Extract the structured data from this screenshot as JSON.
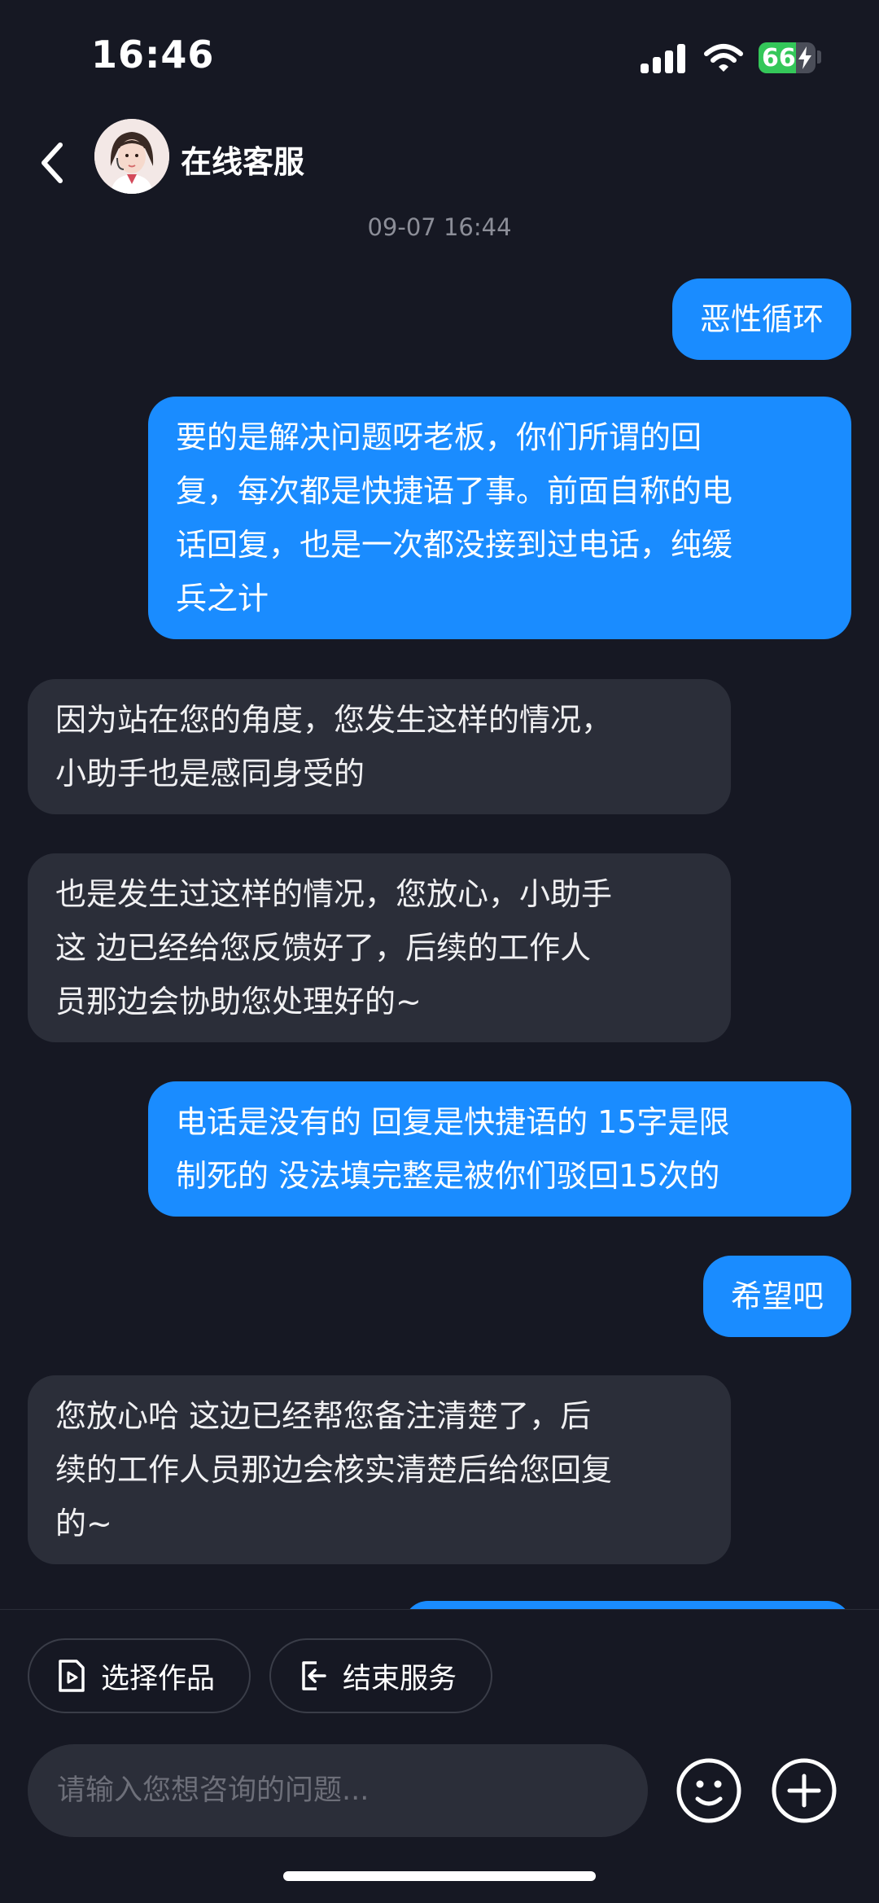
{
  "status_bar": {
    "time": "16:46",
    "battery_percent": "66",
    "battery_level": 0.66,
    "battery_color": "#34c759"
  },
  "header": {
    "back_icon": "chevron-left-icon",
    "title": "在线客服"
  },
  "chat": {
    "timestamp": "09-07 16:44",
    "messages": [
      {
        "from": "me",
        "text": "恶性循环"
      },
      {
        "from": "me",
        "text": "要的是解决问题呀老板，你们所谓的回\n复，每次都是快捷语了事。前面自称的电\n话回复，也是一次都没接到过电话，纯缓\n兵之计"
      },
      {
        "from": "agent",
        "text": "因为站在您的角度，您发生这样的情况，\n小助手也是感同身受的"
      },
      {
        "from": "agent",
        "text": "也是发生过这样的情况，您放心，小助手\n这 边已经给您反馈好了，后续的工作人\n员那边会协助您处理好的~"
      },
      {
        "from": "me",
        "text": "电话是没有的 回复是快捷语的 15字是限\n制死的 没法填完整是被你们驳回15次的"
      },
      {
        "from": "me",
        "text": "希望吧"
      },
      {
        "from": "agent",
        "text": "您放心哈 这边已经帮您备注清楚了，后\n续的工作人员那边会核实清楚后给您回复\n的~"
      }
    ]
  },
  "bottom_bar": {
    "select_work_label": "选择作品",
    "end_service_label": "结束服务",
    "input_placeholder": "请输入您想咨询的问题...",
    "emoji_icon": "emoji-icon",
    "plus_icon": "plus-icon"
  },
  "colors": {
    "background": "#161823",
    "my_bubble": "#1a8cff",
    "agent_bubble": "#2b2e39"
  }
}
